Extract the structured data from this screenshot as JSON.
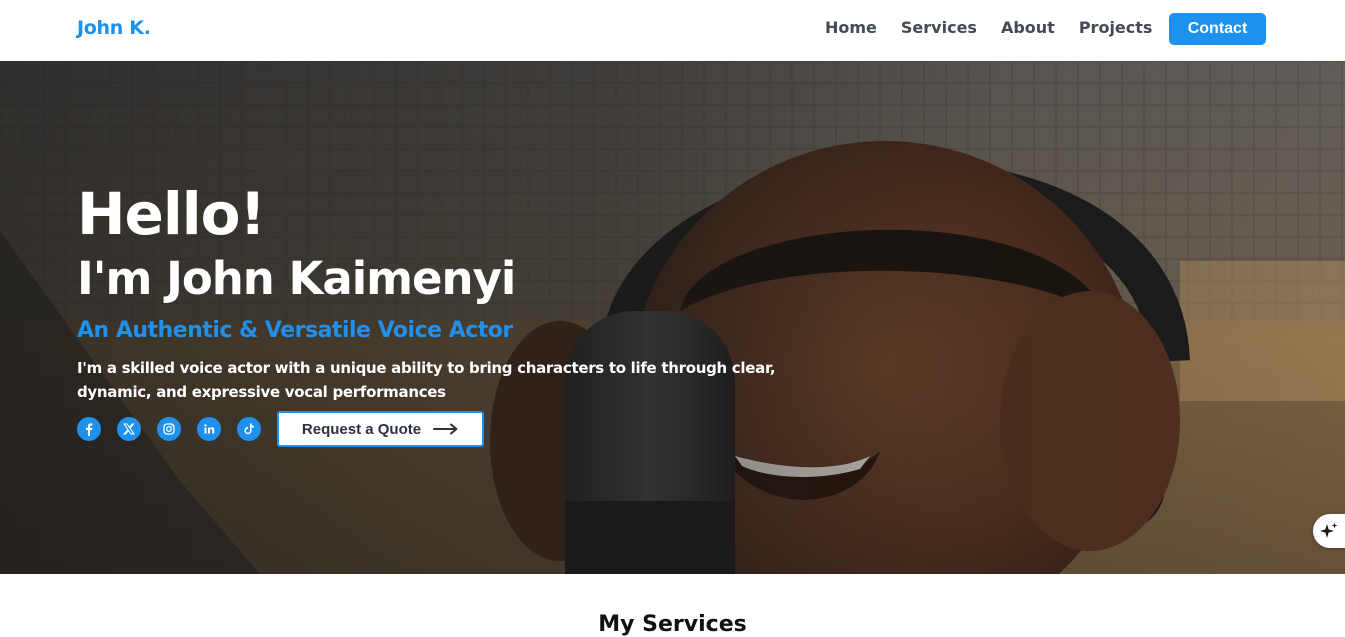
{
  "navbar": {
    "brand": "John K.",
    "links": [
      {
        "label": "Home"
      },
      {
        "label": "Services"
      },
      {
        "label": "About"
      },
      {
        "label": "Projects"
      }
    ],
    "contact_label": "Contact"
  },
  "hero": {
    "greeting": "Hello!",
    "name": "I'm John Kaimenyi",
    "tagline": "An Authentic & Versatile Voice Actor",
    "description": "I'm a skilled voice actor with a unique ability to bring characters to life through clear, dynamic, and expressive vocal performances",
    "social_icons": [
      "facebook-icon",
      "x-twitter-icon",
      "instagram-icon",
      "linkedin-icon",
      "tiktok-icon"
    ],
    "quote_button_label": "Request a Quote"
  },
  "services": {
    "heading": "My Services"
  },
  "colors": {
    "accent": "#1e90ee",
    "nav_text": "#444b55",
    "white": "#ffffff"
  }
}
